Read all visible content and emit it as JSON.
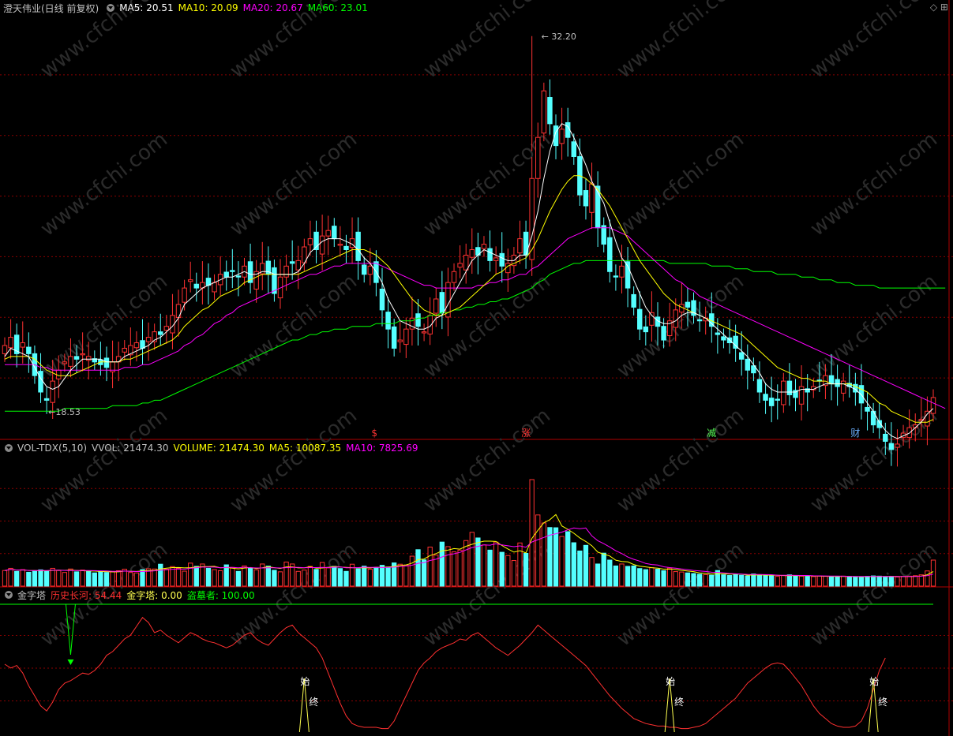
{
  "colors": {
    "up": "#ff3232",
    "down": "#54ffff",
    "ma5": "#ffffff",
    "ma10": "#ffff00",
    "ma20": "#ff00ff",
    "ma60": "#00ff00",
    "grid": "#8b0000",
    "text": "#c0c0c0",
    "history": "#ff3030",
    "jinzita": "#ffff50",
    "daomuzhe": "#00ff00"
  },
  "main_header": {
    "title": "澄天伟业(日线 前复权)",
    "ma5": "MA5: 20.51",
    "ma10": "MA10: 20.09",
    "ma20": "MA20: 20.67",
    "ma60": "MA60: 23.01",
    "corner_icons": "◇ ⊞"
  },
  "vol_header": {
    "title": "VOL-TDX(5,10)",
    "vvol": "VVOL: 21474.30",
    "volume": "VOLUME: 21474.30",
    "ma5": "MA5: 10087.35",
    "ma10": "MA10: 7825.69"
  },
  "ind_header": {
    "title": "金字塔",
    "history": "历史长河: 54.44",
    "jinzita": "金字塔: 0.00",
    "daomuzhe": "盗墓者: 100.00"
  },
  "markers": {
    "high_label": "32.20",
    "low_label": "18.53",
    "events": [
      {
        "text": "$",
        "color": "#ff3232"
      },
      {
        "text": "涨",
        "color": "#ff3232"
      },
      {
        "text": "减",
        "color": "#54ff54"
      },
      {
        "text": "财",
        "color": "#6ab0ff"
      }
    ]
  },
  "signal_labels": {
    "start": "始",
    "end": "终"
  },
  "watermark": "www.cfchi.com",
  "chart_data": [
    {
      "type": "candlestick",
      "title": "澄天伟业(日线 前复权)",
      "ylim": [
        17.5,
        33.0
      ],
      "highest": 32.2,
      "lowest": 18.53,
      "close": [
        20.9,
        21.2,
        20.6,
        21.0,
        20.6,
        19.8,
        19.2,
        18.9,
        19.6,
        20.0,
        20.3,
        20.5,
        20.4,
        20.6,
        20.5,
        20.3,
        20.2,
        20.1,
        20.3,
        20.5,
        20.8,
        20.9,
        21.0,
        20.8,
        21.2,
        21.4,
        21.3,
        21.6,
        22.0,
        22.4,
        23.0,
        23.3,
        23.0,
        23.2,
        23.1,
        23.2,
        23.5,
        23.4,
        23.6,
        23.4,
        23.8,
        23.2,
        23.6,
        23.9,
        23.5,
        22.8,
        23.4,
        23.8,
        23.9,
        24.0,
        24.5,
        24.8,
        24.4,
        24.9,
        25.1,
        24.8,
        24.6,
        24.4,
        24.8,
        24.0,
        23.5,
        23.8,
        23.2,
        22.2,
        21.5,
        20.8,
        21.1,
        21.5,
        21.9,
        21.6,
        21.4,
        22.0,
        22.6,
        22.1,
        23.2,
        23.6,
        23.9,
        24.2,
        24.4,
        24.2,
        24.6,
        24.0,
        24.1,
        23.8,
        23.9,
        24.2,
        24.8,
        24.2,
        27.0,
        28.5,
        30.2,
        29.0,
        28.2,
        28.8,
        28.5,
        27.8,
        26.4,
        26.0,
        26.8,
        25.2,
        24.6,
        23.6,
        23.4,
        23.8,
        23.0,
        22.3,
        21.5,
        21.4,
        22.1,
        21.6,
        21.1,
        21.8,
        22.2,
        22.4,
        22.3,
        22.0,
        21.8,
        21.9,
        21.6,
        21.3,
        21.1,
        21.0,
        20.8,
        20.4,
        20.0,
        19.9,
        19.2,
        18.9,
        18.7,
        18.9,
        19.6,
        19.1,
        19.0,
        19.4,
        19.2,
        19.4,
        19.6,
        19.8,
        19.5,
        19.4,
        19.6,
        19.4,
        19.2,
        18.8,
        18.5,
        18.0,
        17.9,
        17.4,
        17.1,
        17.3,
        17.7,
        17.9,
        18.0,
        18.2,
        18.5,
        19.0
      ],
      "ma5": [
        20.5,
        20.8,
        20.7,
        20.6,
        20.5,
        20.1,
        19.7,
        19.4,
        19.3,
        19.4,
        19.7,
        20.0,
        20.2,
        20.4,
        20.4,
        20.4,
        20.4,
        20.3,
        20.3,
        20.3,
        20.5,
        20.6,
        20.7,
        20.8,
        20.9,
        21.1,
        21.2,
        21.4,
        21.6,
        21.9,
        22.4,
        22.6,
        22.8,
        23.0,
        23.1,
        23.2,
        23.3,
        23.4,
        23.4,
        23.5,
        23.6,
        23.5,
        23.5,
        23.6,
        23.6,
        23.5,
        23.5,
        23.5,
        23.5,
        23.6,
        23.9,
        24.3,
        24.5,
        24.7,
        24.8,
        24.8,
        24.8,
        24.7,
        24.6,
        24.4,
        24.1,
        23.9,
        23.6,
        23.2,
        22.6,
        22.2,
        21.8,
        21.7,
        21.6,
        21.5,
        21.5,
        21.6,
        21.9,
        22.0,
        22.4,
        22.8,
        23.2,
        23.6,
        24.0,
        24.2,
        24.4,
        24.3,
        24.2,
        24.1,
        24.0,
        24.0,
        24.2,
        24.2,
        24.9,
        25.8,
        27.0,
        28.0,
        28.7,
        29.0,
        28.9,
        28.5,
        28.0,
        27.5,
        26.9,
        26.5,
        26.1,
        25.4,
        24.7,
        24.1,
        23.8,
        23.3,
        22.8,
        22.3,
        22.0,
        21.8,
        21.7,
        21.7,
        21.8,
        22.0,
        22.1,
        22.1,
        22.0,
        21.9,
        21.7,
        21.5,
        21.3,
        21.1,
        20.9,
        20.7,
        20.5,
        20.2,
        19.9,
        19.5,
        19.3,
        19.2,
        19.2,
        19.2,
        19.2,
        19.3,
        19.3,
        19.3,
        19.4,
        19.5,
        19.5,
        19.5,
        19.5,
        19.4,
        19.3,
        19.1,
        18.8,
        18.5,
        18.1,
        17.8,
        17.6,
        17.5,
        17.6,
        17.7,
        17.9,
        18.1,
        18.4,
        18.6
      ],
      "ma10": [
        20.4,
        20.5,
        20.5,
        20.5,
        20.5,
        20.4,
        20.2,
        20.0,
        19.9,
        19.8,
        19.8,
        19.8,
        19.9,
        20.0,
        20.1,
        20.2,
        20.3,
        20.3,
        20.3,
        20.3,
        20.4,
        20.4,
        20.5,
        20.6,
        20.7,
        20.8,
        20.9,
        21.0,
        21.1,
        21.3,
        21.6,
        21.8,
        22.0,
        22.2,
        22.3,
        22.5,
        22.7,
        22.8,
        22.9,
        23.0,
        23.2,
        23.3,
        23.4,
        23.5,
        23.5,
        23.5,
        23.5,
        23.5,
        23.5,
        23.5,
        23.6,
        23.7,
        23.8,
        23.9,
        24.0,
        24.1,
        24.2,
        24.3,
        24.4,
        24.4,
        24.4,
        24.3,
        24.2,
        24.0,
        23.8,
        23.5,
        23.2,
        22.9,
        22.6,
        22.4,
        22.2,
        22.1,
        22.0,
        22.0,
        22.1,
        22.2,
        22.3,
        22.5,
        22.7,
        22.9,
        23.1,
        23.3,
        23.5,
        23.6,
        23.8,
        23.9,
        24.0,
        24.1,
        24.4,
        24.8,
        25.3,
        25.8,
        26.2,
        26.6,
        26.9,
        27.1,
        27.1,
        27.0,
        26.8,
        26.6,
        26.3,
        26.0,
        25.6,
        25.2,
        24.8,
        24.4,
        24.0,
        23.7,
        23.4,
        23.1,
        22.8,
        22.6,
        22.4,
        22.3,
        22.2,
        22.1,
        22.0,
        21.9,
        21.8,
        21.7,
        21.6,
        21.5,
        21.4,
        21.3,
        21.1,
        20.9,
        20.7,
        20.5,
        20.3,
        20.1,
        20.0,
        19.9,
        19.8,
        19.7,
        19.7,
        19.6,
        19.6,
        19.6,
        19.5,
        19.5,
        19.5,
        19.5,
        19.4,
        19.3,
        19.2,
        19.0,
        18.8,
        18.7,
        18.5,
        18.4,
        18.3,
        18.2,
        18.1,
        18.1,
        18.1,
        18.2
      ],
      "ma20": [
        20.2,
        20.2,
        20.2,
        20.2,
        20.2,
        20.2,
        20.1,
        20.1,
        20.0,
        20.0,
        20.0,
        20.0,
        20.0,
        20.0,
        20.0,
        20.0,
        20.0,
        20.0,
        20.0,
        20.0,
        20.1,
        20.1,
        20.1,
        20.2,
        20.2,
        20.3,
        20.4,
        20.5,
        20.6,
        20.7,
        20.9,
        21.0,
        21.2,
        21.3,
        21.5,
        21.7,
        21.8,
        22.0,
        22.1,
        22.3,
        22.4,
        22.5,
        22.6,
        22.7,
        22.8,
        22.9,
        23.0,
        23.1,
        23.2,
        23.3,
        23.4,
        23.5,
        23.5,
        23.6,
        23.7,
        23.8,
        23.8,
        23.9,
        23.9,
        23.9,
        23.9,
        23.9,
        23.9,
        23.8,
        23.7,
        23.6,
        23.5,
        23.4,
        23.3,
        23.2,
        23.1,
        23.1,
        23.0,
        23.0,
        23.0,
        23.0,
        23.0,
        23.0,
        23.0,
        23.1,
        23.1,
        23.2,
        23.2,
        23.3,
        23.3,
        23.4,
        23.5,
        23.5,
        23.7,
        23.8,
        24.0,
        24.2,
        24.4,
        24.6,
        24.8,
        24.9,
        25.0,
        25.1,
        25.2,
        25.2,
        25.2,
        25.2,
        25.1,
        25.0,
        24.9,
        24.7,
        24.5,
        24.3,
        24.1,
        23.9,
        23.7,
        23.5,
        23.3,
        23.2,
        23.0,
        22.9,
        22.7,
        22.6,
        22.5,
        22.4,
        22.3,
        22.2,
        22.1,
        22.0,
        21.9,
        21.8,
        21.7,
        21.6,
        21.5,
        21.4,
        21.3,
        21.2,
        21.1,
        21.0,
        20.9,
        20.8,
        20.7,
        20.6,
        20.5,
        20.4,
        20.3,
        20.2,
        20.1,
        20.0,
        19.9,
        19.8,
        19.7,
        19.6,
        19.5,
        19.4,
        19.3,
        19.2,
        19.1,
        19.0,
        18.9,
        18.8,
        18.7,
        18.6
      ],
      "ma60": [
        18.5,
        18.5,
        18.5,
        18.5,
        18.5,
        18.5,
        18.5,
        18.5,
        18.5,
        18.5,
        18.6,
        18.6,
        18.6,
        18.6,
        18.6,
        18.6,
        18.6,
        18.6,
        18.7,
        18.7,
        18.7,
        18.7,
        18.7,
        18.8,
        18.8,
        18.9,
        18.9,
        19.0,
        19.1,
        19.2,
        19.3,
        19.4,
        19.5,
        19.6,
        19.7,
        19.8,
        19.9,
        20.0,
        20.1,
        20.2,
        20.3,
        20.4,
        20.5,
        20.6,
        20.7,
        20.8,
        20.9,
        21.0,
        21.1,
        21.1,
        21.2,
        21.3,
        21.3,
        21.4,
        21.4,
        21.5,
        21.5,
        21.5,
        21.6,
        21.6,
        21.6,
        21.6,
        21.7,
        21.7,
        21.7,
        21.7,
        21.8,
        21.8,
        21.8,
        21.9,
        21.9,
        22.0,
        22.0,
        22.1,
        22.1,
        22.2,
        22.2,
        22.3,
        22.3,
        22.4,
        22.4,
        22.5,
        22.5,
        22.6,
        22.6,
        22.7,
        22.8,
        22.9,
        23.0,
        23.2,
        23.3,
        23.5,
        23.6,
        23.7,
        23.8,
        23.9,
        23.9,
        24.0,
        24.0,
        24.0,
        24.0,
        24.0,
        24.0,
        24.0,
        24.0,
        24.0,
        24.0,
        24.0,
        24.0,
        24.0,
        24.0,
        23.9,
        23.9,
        23.9,
        23.9,
        23.9,
        23.9,
        23.9,
        23.8,
        23.8,
        23.8,
        23.8,
        23.7,
        23.7,
        23.7,
        23.6,
        23.6,
        23.6,
        23.6,
        23.5,
        23.5,
        23.5,
        23.5,
        23.4,
        23.4,
        23.4,
        23.3,
        23.3,
        23.3,
        23.2,
        23.2,
        23.2,
        23.1,
        23.1,
        23.1,
        23.1,
        23.0,
        23.0,
        23.0,
        23.0,
        23.0,
        23.0,
        23.0,
        23.0,
        23.0,
        23.0,
        23.0,
        23.0
      ]
    },
    {
      "type": "bar",
      "title": "VOL-TDX(5,10)",
      "ylim": [
        0,
        60000
      ],
      "volume": [
        7200,
        8200,
        6800,
        7600,
        6400,
        6900,
        7500,
        7100,
        8200,
        7200,
        6300,
        7900,
        6600,
        7400,
        6800,
        6100,
        6900,
        6300,
        6600,
        7100,
        7800,
        6300,
        6100,
        7600,
        8000,
        7900,
        10100,
        7800,
        9000,
        8200,
        6900,
        10600,
        9100,
        10200,
        8200,
        7600,
        7100,
        9800,
        8600,
        6800,
        9300,
        8400,
        7500,
        10200,
        9200,
        7300,
        6600,
        11100,
        10200,
        6800,
        7400,
        9100,
        7700,
        10900,
        8400,
        9100,
        8100,
        6800,
        10100,
        8000,
        9200,
        7800,
        8600,
        9600,
        8800,
        10700,
        10100,
        9700,
        13800,
        16800,
        12100,
        18000,
        14300,
        20300,
        18200,
        15800,
        16600,
        21000,
        24800,
        22200,
        19000,
        16600,
        20300,
        15600,
        14100,
        11800,
        19900,
        15100,
        49100,
        32800,
        29100,
        27000,
        26900,
        22900,
        25100,
        20000,
        16200,
        18800,
        13200,
        10200,
        15200,
        12000,
        9300,
        10200,
        9100,
        9300,
        8100,
        7600,
        8500,
        7800,
        7100,
        8300,
        6700,
        6500,
        6100,
        5800,
        5500,
        5300,
        5000,
        7200,
        5200,
        4900,
        5400,
        5000,
        4700,
        5600,
        5300,
        4900,
        4700,
        4500,
        4900,
        5200,
        4800,
        4600,
        4500,
        4400,
        4700,
        4500,
        4400,
        4300,
        4600,
        4400,
        4300,
        4100,
        4500,
        4700,
        4600,
        4300,
        4400,
        4200,
        4500,
        4600,
        4800,
        5200,
        7000,
        12000
      ],
      "ma5_label": "10087.35",
      "ma10_label": "7825.69"
    },
    {
      "type": "line",
      "title": "金字塔",
      "ylim": [
        0,
        100
      ],
      "history": [
        55,
        52,
        54,
        48,
        38,
        30,
        22,
        18,
        25,
        35,
        40,
        42,
        45,
        48,
        47,
        50,
        55,
        62,
        65,
        70,
        75,
        78,
        85,
        92,
        88,
        80,
        82,
        78,
        75,
        72,
        76,
        80,
        78,
        75,
        73,
        72,
        70,
        68,
        70,
        74,
        78,
        80,
        75,
        72,
        70,
        75,
        80,
        84,
        86,
        80,
        76,
        72,
        68,
        60,
        48,
        36,
        24,
        14,
        8,
        6,
        5,
        5,
        5,
        4,
        4,
        10,
        20,
        30,
        40,
        50,
        56,
        60,
        65,
        68,
        70,
        72,
        75,
        74,
        78,
        80,
        76,
        72,
        68,
        65,
        62,
        66,
        70,
        75,
        80,
        86,
        82,
        78,
        74,
        70,
        66,
        62,
        58,
        54,
        48,
        42,
        36,
        30,
        25,
        20,
        16,
        12,
        10,
        8,
        7,
        6,
        6,
        5,
        5,
        4,
        4,
        5,
        6,
        8,
        12,
        16,
        20,
        24,
        28,
        34,
        40,
        44,
        48,
        52,
        55,
        56,
        55,
        50,
        44,
        38,
        30,
        22,
        16,
        12,
        8,
        6,
        5,
        5,
        6,
        10,
        20,
        35,
        50,
        60
      ],
      "jinzita": [
        {
          "i": 50,
          "v": 0
        },
        {
          "i": 111,
          "v": 0
        },
        {
          "i": 145,
          "v": 0
        }
      ],
      "daomuzhe": 100,
      "down_signal_index": 11
    }
  ]
}
